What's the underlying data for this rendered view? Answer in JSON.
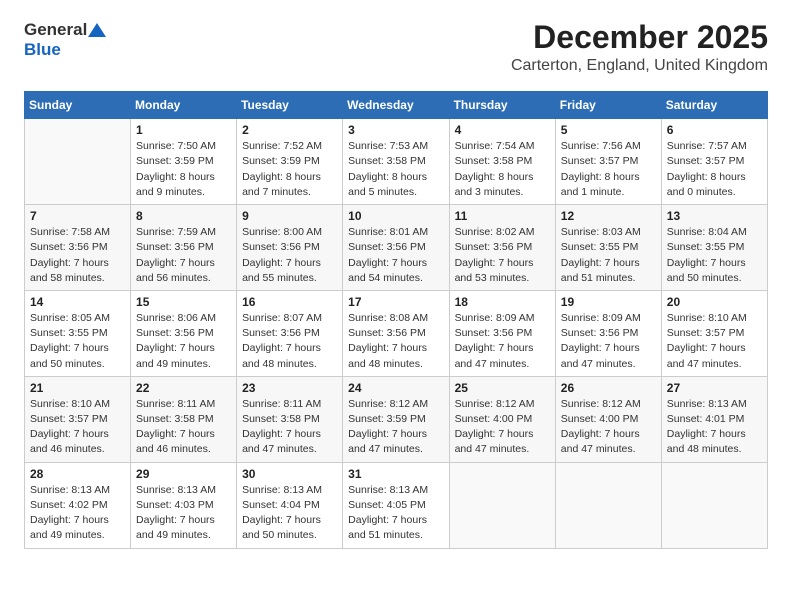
{
  "logo": {
    "general": "General",
    "blue": "Blue"
  },
  "header": {
    "title": "December 2025",
    "subtitle": "Carterton, England, United Kingdom"
  },
  "calendar": {
    "days_of_week": [
      "Sunday",
      "Monday",
      "Tuesday",
      "Wednesday",
      "Thursday",
      "Friday",
      "Saturday"
    ],
    "weeks": [
      [
        {
          "day": "",
          "info": ""
        },
        {
          "day": "1",
          "info": "Sunrise: 7:50 AM\nSunset: 3:59 PM\nDaylight: 8 hours\nand 9 minutes."
        },
        {
          "day": "2",
          "info": "Sunrise: 7:52 AM\nSunset: 3:59 PM\nDaylight: 8 hours\nand 7 minutes."
        },
        {
          "day": "3",
          "info": "Sunrise: 7:53 AM\nSunset: 3:58 PM\nDaylight: 8 hours\nand 5 minutes."
        },
        {
          "day": "4",
          "info": "Sunrise: 7:54 AM\nSunset: 3:58 PM\nDaylight: 8 hours\nand 3 minutes."
        },
        {
          "day": "5",
          "info": "Sunrise: 7:56 AM\nSunset: 3:57 PM\nDaylight: 8 hours\nand 1 minute."
        },
        {
          "day": "6",
          "info": "Sunrise: 7:57 AM\nSunset: 3:57 PM\nDaylight: 8 hours\nand 0 minutes."
        }
      ],
      [
        {
          "day": "7",
          "info": "Sunrise: 7:58 AM\nSunset: 3:56 PM\nDaylight: 7 hours\nand 58 minutes."
        },
        {
          "day": "8",
          "info": "Sunrise: 7:59 AM\nSunset: 3:56 PM\nDaylight: 7 hours\nand 56 minutes."
        },
        {
          "day": "9",
          "info": "Sunrise: 8:00 AM\nSunset: 3:56 PM\nDaylight: 7 hours\nand 55 minutes."
        },
        {
          "day": "10",
          "info": "Sunrise: 8:01 AM\nSunset: 3:56 PM\nDaylight: 7 hours\nand 54 minutes."
        },
        {
          "day": "11",
          "info": "Sunrise: 8:02 AM\nSunset: 3:56 PM\nDaylight: 7 hours\nand 53 minutes."
        },
        {
          "day": "12",
          "info": "Sunrise: 8:03 AM\nSunset: 3:55 PM\nDaylight: 7 hours\nand 51 minutes."
        },
        {
          "day": "13",
          "info": "Sunrise: 8:04 AM\nSunset: 3:55 PM\nDaylight: 7 hours\nand 50 minutes."
        }
      ],
      [
        {
          "day": "14",
          "info": "Sunrise: 8:05 AM\nSunset: 3:55 PM\nDaylight: 7 hours\nand 50 minutes."
        },
        {
          "day": "15",
          "info": "Sunrise: 8:06 AM\nSunset: 3:56 PM\nDaylight: 7 hours\nand 49 minutes."
        },
        {
          "day": "16",
          "info": "Sunrise: 8:07 AM\nSunset: 3:56 PM\nDaylight: 7 hours\nand 48 minutes."
        },
        {
          "day": "17",
          "info": "Sunrise: 8:08 AM\nSunset: 3:56 PM\nDaylight: 7 hours\nand 48 minutes."
        },
        {
          "day": "18",
          "info": "Sunrise: 8:09 AM\nSunset: 3:56 PM\nDaylight: 7 hours\nand 47 minutes."
        },
        {
          "day": "19",
          "info": "Sunrise: 8:09 AM\nSunset: 3:56 PM\nDaylight: 7 hours\nand 47 minutes."
        },
        {
          "day": "20",
          "info": "Sunrise: 8:10 AM\nSunset: 3:57 PM\nDaylight: 7 hours\nand 47 minutes."
        }
      ],
      [
        {
          "day": "21",
          "info": "Sunrise: 8:10 AM\nSunset: 3:57 PM\nDaylight: 7 hours\nand 46 minutes."
        },
        {
          "day": "22",
          "info": "Sunrise: 8:11 AM\nSunset: 3:58 PM\nDaylight: 7 hours\nand 46 minutes."
        },
        {
          "day": "23",
          "info": "Sunrise: 8:11 AM\nSunset: 3:58 PM\nDaylight: 7 hours\nand 47 minutes."
        },
        {
          "day": "24",
          "info": "Sunrise: 8:12 AM\nSunset: 3:59 PM\nDaylight: 7 hours\nand 47 minutes."
        },
        {
          "day": "25",
          "info": "Sunrise: 8:12 AM\nSunset: 4:00 PM\nDaylight: 7 hours\nand 47 minutes."
        },
        {
          "day": "26",
          "info": "Sunrise: 8:12 AM\nSunset: 4:00 PM\nDaylight: 7 hours\nand 47 minutes."
        },
        {
          "day": "27",
          "info": "Sunrise: 8:13 AM\nSunset: 4:01 PM\nDaylight: 7 hours\nand 48 minutes."
        }
      ],
      [
        {
          "day": "28",
          "info": "Sunrise: 8:13 AM\nSunset: 4:02 PM\nDaylight: 7 hours\nand 49 minutes."
        },
        {
          "day": "29",
          "info": "Sunrise: 8:13 AM\nSunset: 4:03 PM\nDaylight: 7 hours\nand 49 minutes."
        },
        {
          "day": "30",
          "info": "Sunrise: 8:13 AM\nSunset: 4:04 PM\nDaylight: 7 hours\nand 50 minutes."
        },
        {
          "day": "31",
          "info": "Sunrise: 8:13 AM\nSunset: 4:05 PM\nDaylight: 7 hours\nand 51 minutes."
        },
        {
          "day": "",
          "info": ""
        },
        {
          "day": "",
          "info": ""
        },
        {
          "day": "",
          "info": ""
        }
      ]
    ]
  }
}
